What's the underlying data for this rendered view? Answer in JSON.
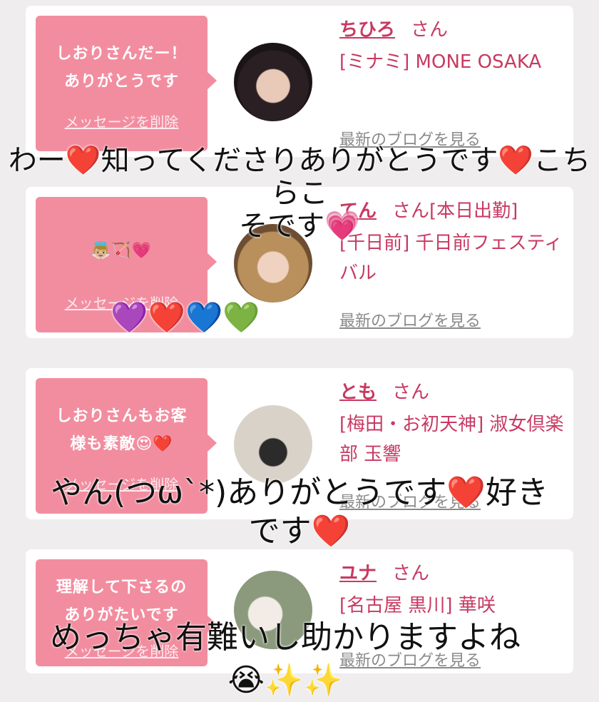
{
  "cards": [
    {
      "bubble_lines": [
        "しおりさんだー！",
        "ありがとうです"
      ],
      "delete_label": "メッセージを削除",
      "name": "ちひろ",
      "honorific": "さん",
      "status": "",
      "shop": "[ミナミ] MONE OSAKA",
      "blog_label": "最新のブログを見る"
    },
    {
      "bubble_lines": [
        "👼🏼🏹💗"
      ],
      "delete_label": "メッセージを削除",
      "name": "てん",
      "honorific": "さん",
      "status": "[本日出勤]",
      "shop": "[千日前] 千日前フェスティバル",
      "blog_label": "最新のブログを見る"
    },
    {
      "bubble_lines": [
        "しおりさんもお客",
        "様も素敵😍❤️"
      ],
      "delete_label": "メッセージを削除",
      "name": "とも",
      "honorific": "さん",
      "status": "",
      "shop": "[梅田・お初天神] 淑女倶楽部 玉響",
      "blog_label": "最新のブログを見る"
    },
    {
      "bubble_lines": [
        "理解して下さるの",
        "ありがたいです"
      ],
      "delete_label": "メッセージを削除",
      "name": "ユナ",
      "honorific": "さん",
      "status": "",
      "shop": "[名古屋 黒川] 華咲",
      "blog_label": "最新のブログを見る"
    }
  ],
  "captions": {
    "c1_line1": "わー❤️知ってくださりありがとうです❤️こちらこ",
    "c1_line2": "そです💗",
    "hearts_row": "💜❤️💙💚",
    "c2_line1": "やん(つω`*)ありがとうです❤️好き",
    "c2_line2": "です❤️",
    "c3_line1": "めっちゃ有難いし助かりますよね",
    "c3_line2": "😭✨✨"
  },
  "colors": {
    "background": "#efeded",
    "bubble": "#f28da0",
    "accent_text": "#c73a62",
    "link_gray": "#8a8a8a"
  }
}
